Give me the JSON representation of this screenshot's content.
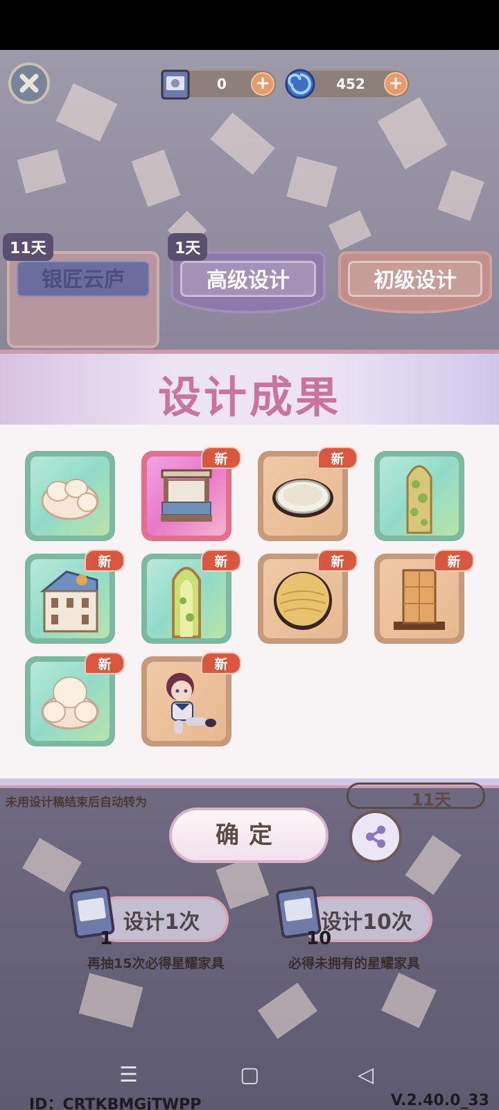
{
  "currencies": {
    "ticket_count": "0",
    "swirl_count": "452",
    "ticket_icon": "design-ticket-icon",
    "swirl_icon": "blue-swirl-icon"
  },
  "banners": [
    {
      "label": "银匠云庐",
      "badge": "11天"
    },
    {
      "label": "高级设计",
      "badge": "1天"
    },
    {
      "label": "初级设计",
      "badge": ""
    }
  ],
  "modal": {
    "title": "设计成果",
    "items": [
      {
        "name": "白色软垫团",
        "rarity": "green",
        "new": ""
      },
      {
        "name": "古典床榻",
        "rarity": "pink",
        "new": "新"
      },
      {
        "name": "圆盘",
        "rarity": "brown",
        "new": "新"
      },
      {
        "name": "花藤拱门",
        "rarity": "green",
        "new": ""
      },
      {
        "name": "小房子模型",
        "rarity": "green",
        "new": "新"
      },
      {
        "name": "绿光拱门",
        "rarity": "green",
        "new": "新"
      },
      {
        "name": "金色圆球",
        "rarity": "brown",
        "new": "新"
      },
      {
        "name": "木柱",
        "rarity": "brown",
        "new": "新"
      },
      {
        "name": "白色软垫",
        "rarity": "green",
        "new": "新"
      },
      {
        "name": "人偶",
        "rarity": "brown",
        "new": "新"
      }
    ]
  },
  "footer": {
    "pool_note": "未用设计稿结束后自动转为",
    "days_left": "11天",
    "confirm_label": "确定",
    "draw_one_label": "设计1次",
    "draw_one_cost": "1",
    "draw_one_hint": "再抽15次必得星耀家具",
    "draw_ten_label": "设计10次",
    "draw_ten_cost": "10",
    "draw_ten_hint": "必得未拥有的星耀家具",
    "player_id": "ID：CRTKBMGjTWPP",
    "version": "V.2.40.0_33"
  },
  "colors": {
    "title_pink": "#c8749c",
    "new_tag": "#d9573f"
  }
}
